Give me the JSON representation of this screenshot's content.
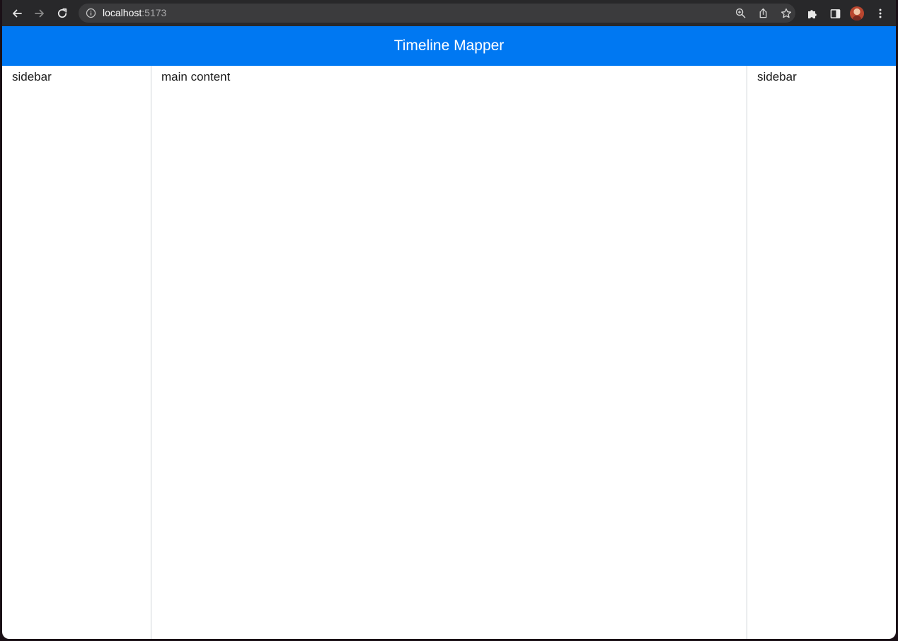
{
  "browser": {
    "url_host": "localhost",
    "url_port": ":5173",
    "icons": {
      "back": "arrow-left-icon",
      "forward": "arrow-right-icon",
      "reload": "reload-icon",
      "info": "info-icon",
      "zoom": "zoom-icon",
      "share": "share-icon",
      "bookmark": "star-icon",
      "extensions": "puzzle-icon",
      "side_panel": "side-panel-icon",
      "profile": "avatar",
      "menu": "kebab-menu-icon"
    }
  },
  "app": {
    "title": "Timeline Mapper",
    "header_color": "#0078f2"
  },
  "layout": {
    "left_sidebar_label": "sidebar",
    "main_label": "main content",
    "right_sidebar_label": "sidebar"
  }
}
